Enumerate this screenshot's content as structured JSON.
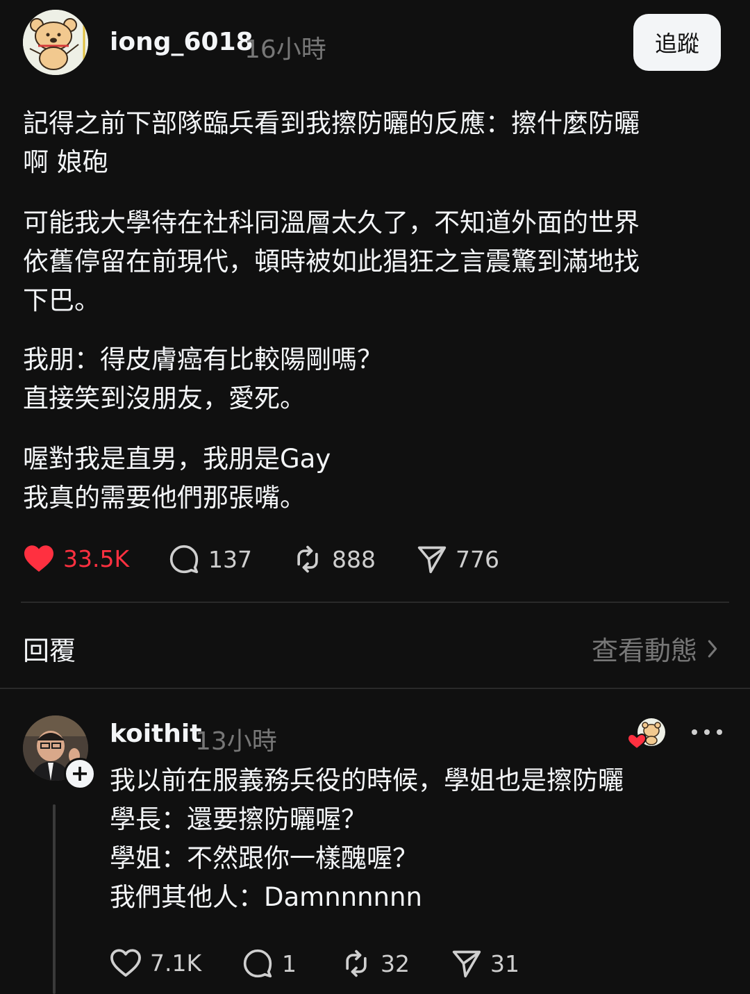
{
  "post": {
    "username": "iong_6018",
    "time": "16小時",
    "follow_label": "追蹤",
    "paragraphs": [
      "記得之前下部隊臨兵看到我擦防曬的反應：擦什麼防曬\n啊 娘砲",
      "可能我大學待在社科同溫層太久了，不知道外面的世界\n依舊停留在前現代，頓時被如此猖狂之言震驚到滿地找\n下巴。",
      "我朋：得皮膚癌有比較陽剛嗎？\n直接笑到沒朋友，愛死。",
      "喔對我是直男，我朋是Gay\n我真的需要他們那張嘴。"
    ],
    "likes": "33.5K",
    "comments": "137",
    "reposts": "888",
    "shares": "776"
  },
  "replies_section": {
    "label": "回覆",
    "activity_label": "查看動態"
  },
  "reply": {
    "username": "koithit",
    "time": "13小時",
    "text": "我以前在服義務兵役的時候，學姐也是擦防曬\n學長：還要擦防曬喔？\n學姐：不然跟你一樣醜喔？\n我們其他人：Damnnnnnn",
    "likes": "7.1K",
    "comments": "1",
    "reposts": "32",
    "shares": "31"
  },
  "colors": {
    "background": "#101010",
    "text": "#f3f5f7",
    "muted": "#777777",
    "like_red": "#ff3040"
  }
}
